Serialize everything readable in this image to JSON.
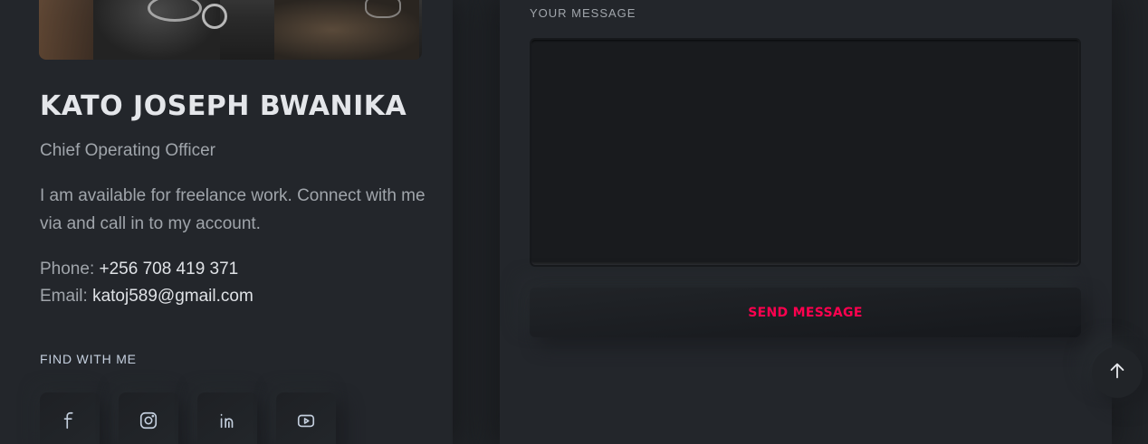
{
  "profile": {
    "name": "KATO JOSEPH BWANIKA",
    "role": "Chief Operating Officer",
    "description": "I am available for freelance work. Connect with me via and call in to my account.",
    "phone_label": "Phone: ",
    "phone_value": "+256 708 419 371",
    "email_label": "Email: ",
    "email_value": "katoj589@gmail.com"
  },
  "social": {
    "heading": "FIND WITH ME",
    "items": [
      {
        "icon": "facebook-icon"
      },
      {
        "icon": "instagram-icon"
      },
      {
        "icon": "linkedin-icon"
      },
      {
        "icon": "youtube-icon"
      }
    ]
  },
  "contact_form": {
    "message_label": "YOUR MESSAGE",
    "message_value": "",
    "send_label": "SEND MESSAGE"
  },
  "colors": {
    "accent": "#ff014f",
    "background": "#212428",
    "text_muted": "#a0a5ab"
  }
}
